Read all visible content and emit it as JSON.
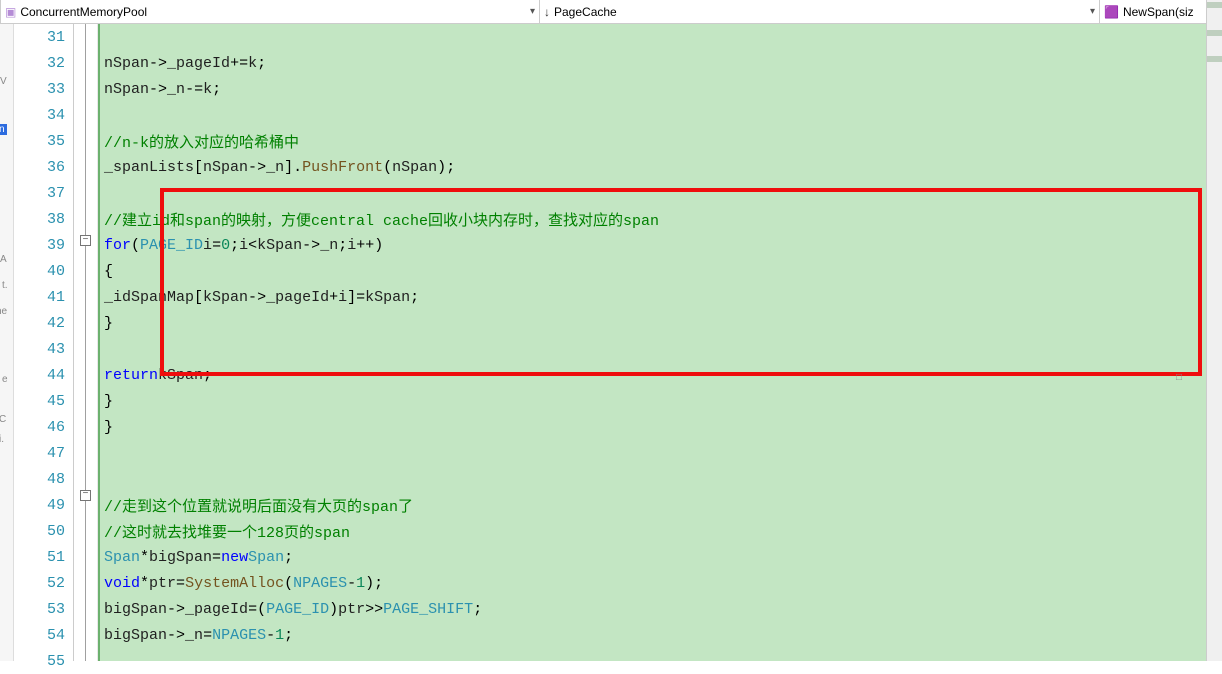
{
  "topbar": {
    "dd1": {
      "icon": "▣",
      "label": "ConcurrentMemoryPool"
    },
    "dd2": {
      "icon": "↓",
      "label": "PageCache"
    },
    "dd3": {
      "icon": "⬚",
      "label": "NewSpan(siz"
    }
  },
  "line_start": 31,
  "code_lines": [
    "",
    "                nSpan->_pageId += k;",
    "                nSpan->_n -= k;",
    "",
    "                //n-k的放入对应的哈希桶中",
    "                _spanLists[nSpan->_n].PushFront(nSpan);",
    "",
    "                //建立id和span的映射，方便central cache回收小块内存时，查找对应的span",
    "                for (PAGE_ID i = 0;i < kSpan->_n;i++)",
    "                {",
    "                    _idSpanMap[kSpan->_pageId + i] = kSpan;",
    "                }",
    "",
    "                return kSpan;",
    "            }",
    "        }",
    "",
    "",
    "        //走到这个位置就说明后面没有大页的span了",
    "        //这时就去找堆要一个128页的span",
    "        Span* bigSpan = new Span;",
    "        void* ptr = SystemAlloc(NPAGES - 1);",
    "        bigSpan->_pageId = (PAGE_ID)ptr >> PAGE_SHIFT;",
    "        bigSpan->_n = NPAGES - 1;",
    ""
  ],
  "fold_rows": {
    "8": "minus",
    "18": "minus"
  },
  "colors": {
    "bg_code": "#C3E6C3",
    "changebar": "#6CB16E",
    "highlight_border": "#ef0d0d"
  },
  "highlight_box": {
    "top_row_idx": 6,
    "bottom_row_idx": 12
  }
}
